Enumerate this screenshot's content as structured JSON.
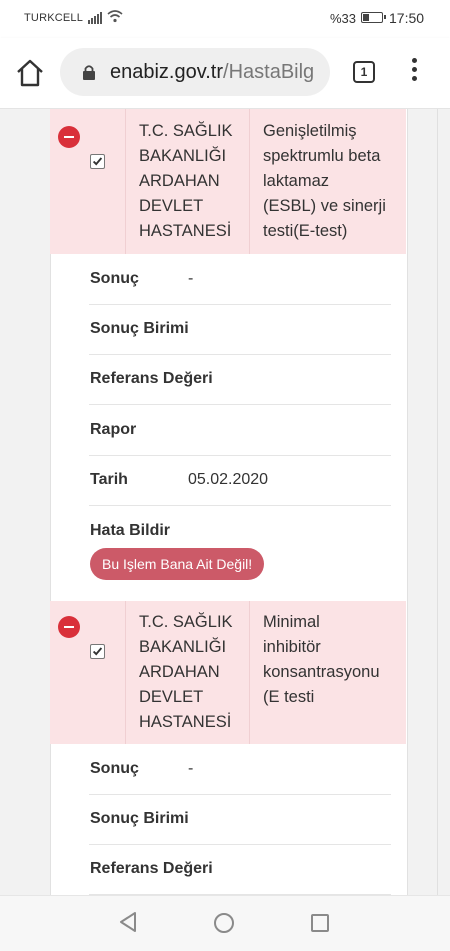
{
  "status_bar": {
    "carrier": "TURKCELL",
    "battery": "%33",
    "battery_level": 0.33,
    "time": "17:50"
  },
  "browser": {
    "url_domain": "enabiz.gov.tr",
    "url_path": "/HastaBilg",
    "tab_count": "1"
  },
  "records": [
    {
      "hospital_lines": [
        "T.C. SAĞLIK",
        "BAKANLIĞI",
        "ARDAHAN",
        "DEVLET",
        "HASTANESİ"
      ],
      "test_lines": [
        "Genişletilmiş",
        "spektrumlu beta",
        "laktamaz",
        "(ESBL) ve sinerji",
        "testi(E-test)"
      ],
      "checked": true,
      "fields": [
        {
          "label": "Sonuç",
          "value": "-"
        },
        {
          "label": "Sonuç Birimi",
          "value": ""
        },
        {
          "label": "Referans Değeri",
          "value": ""
        },
        {
          "label": "Rapor",
          "value": ""
        },
        {
          "label": "Tarih",
          "value": "05.02.2020"
        }
      ],
      "error_label": "Hata Bildir",
      "error_button": "Bu Işlem Bana Ait Değil!"
    },
    {
      "hospital_lines": [
        "T.C. SAĞLIK",
        "BAKANLIĞI",
        "ARDAHAN",
        "DEVLET",
        "HASTANESİ"
      ],
      "test_lines": [
        "Minimal",
        "inhibitör",
        "konsantrasyonu",
        "(E testi"
      ],
      "checked": true,
      "fields": [
        {
          "label": "Sonuç",
          "value": "-"
        },
        {
          "label": "Sonuç Birimi",
          "value": ""
        },
        {
          "label": "Referans Değeri",
          "value": ""
        }
      ]
    }
  ],
  "icons": {
    "home": "home-icon",
    "lock": "lock-icon",
    "tabs": "tabs-icon",
    "menu": "more-vert-icon",
    "remove": "remove-circle-icon",
    "checkbox": "checkbox-icon",
    "nav_back": "nav-back-icon",
    "nav_home": "nav-home-icon",
    "nav_recent": "nav-recent-icon"
  },
  "colors": {
    "header_bg": "#fbe3e5",
    "remove_red": "#d9303a",
    "error_button": "#cc5a68"
  }
}
